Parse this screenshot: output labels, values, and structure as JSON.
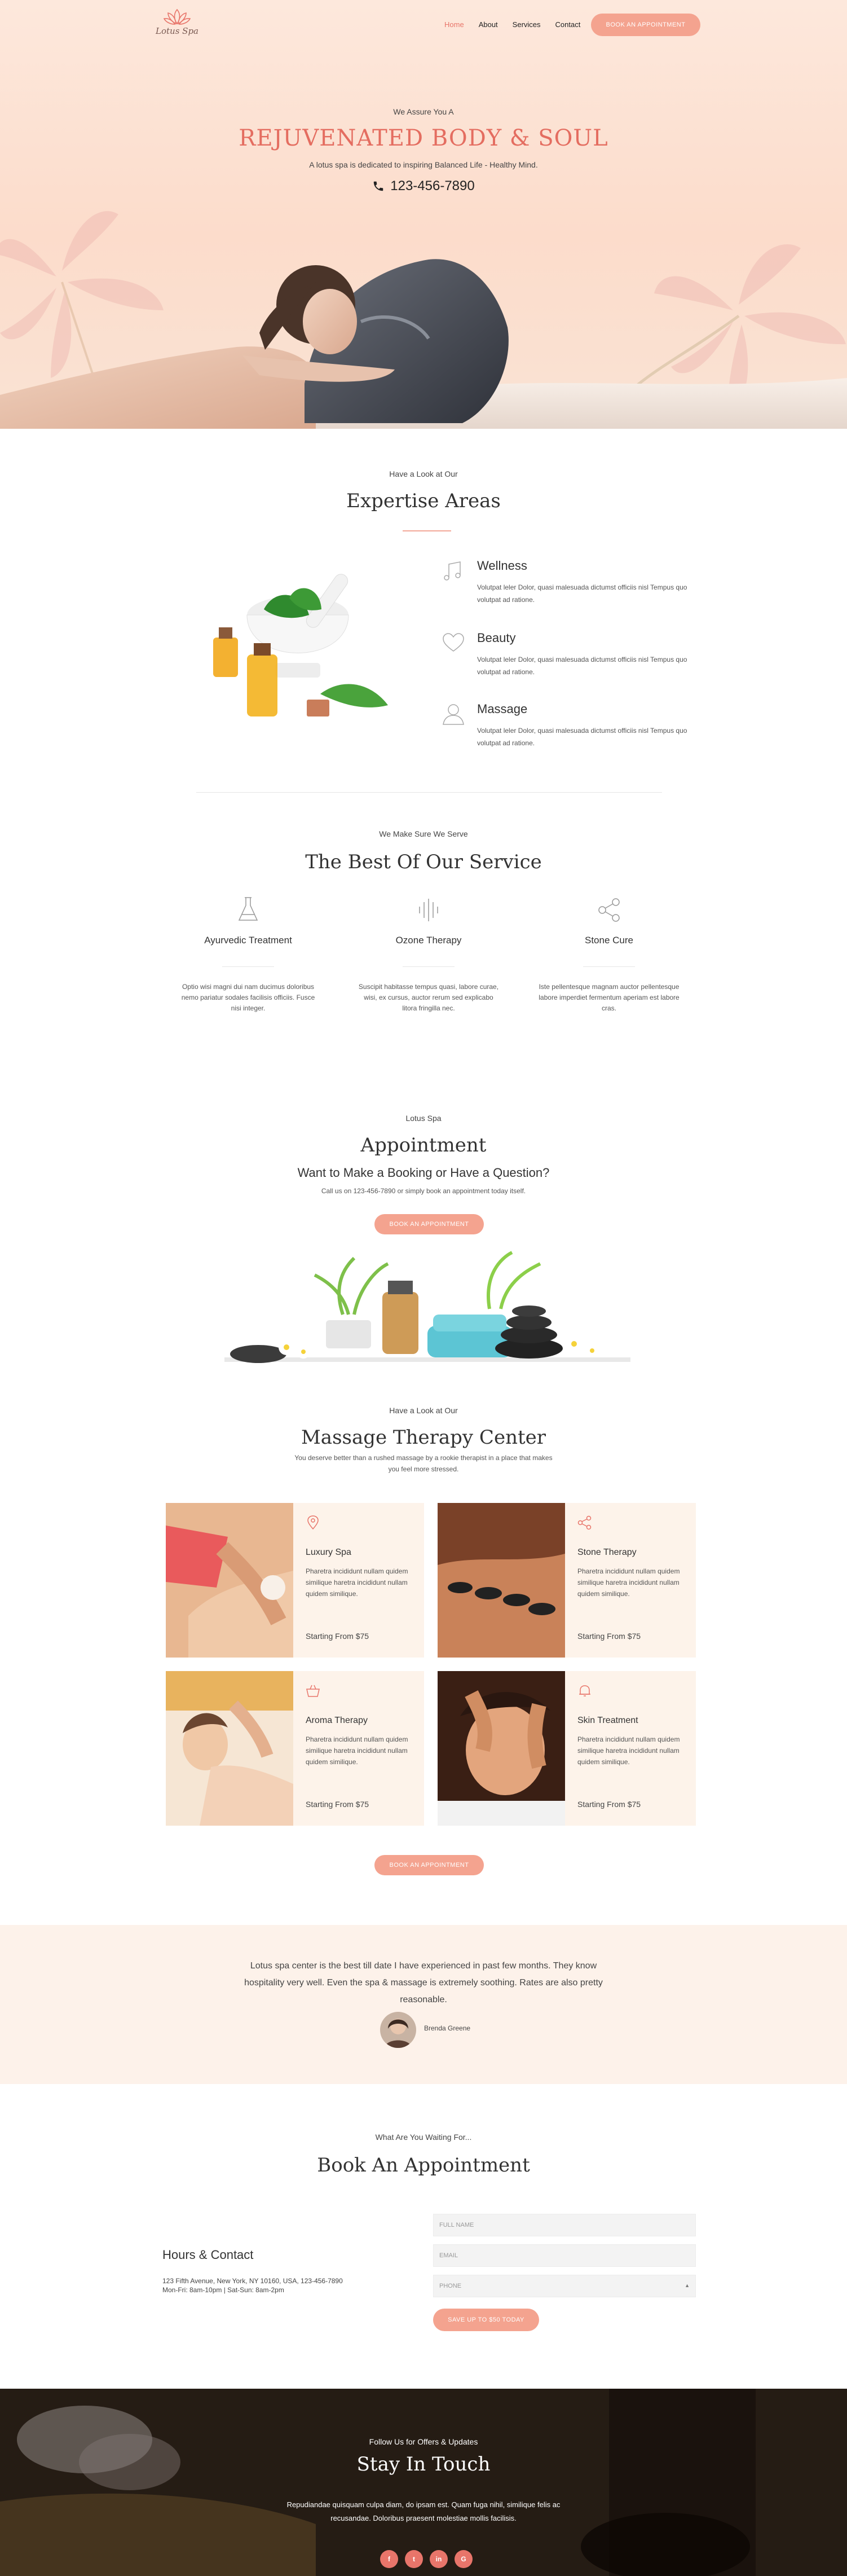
{
  "brand": {
    "logo_text": "Lotus Spa"
  },
  "nav": {
    "links": [
      "Home",
      "About",
      "Services",
      "Contact"
    ],
    "cta": "BOOK AN APPOINTMENT"
  },
  "hero": {
    "kicker": "We Assure You A",
    "title": "REJUVENATED BODY & SOUL",
    "subtitle": "A lotus spa is dedicated to inspiring Balanced Life - Healthy Mind.",
    "phone": "123-456-7890"
  },
  "expertise": {
    "kicker": "Have a Look at Our",
    "title": "Expertise Areas",
    "items": [
      {
        "icon": "music-note-icon",
        "title": "Wellness",
        "text": "Volutpat leler Dolor, quasi malesuada dictumst officiis nisl Tempus quo volutpat ad ratione."
      },
      {
        "icon": "heart-icon",
        "title": "Beauty",
        "text": "Volutpat leler Dolor, quasi malesuada dictumst officiis nisl Tempus quo volutpat ad ratione."
      },
      {
        "icon": "user-icon",
        "title": "Massage",
        "text": "Volutpat leler Dolor, quasi malesuada dictumst officiis nisl Tempus quo volutpat ad ratione."
      }
    ]
  },
  "services": {
    "kicker": "We Make Sure We Serve",
    "title": "The Best Of Our Service",
    "items": [
      {
        "icon": "flask-icon",
        "title": "Ayurvedic Treatment",
        "text": "Optio wisi magni dui nam ducimus doloribus nemo pariatur sodales facilisis officiis. Fusce nisi integer."
      },
      {
        "icon": "soundwave-icon",
        "title": "Ozone Therapy",
        "text": "Suscipit habitasse tempus quasi, labore curae, wisi, ex cursus, auctor rerum sed explicabo litora fringilla nec."
      },
      {
        "icon": "share-icon",
        "title": "Stone Cure",
        "text": "Iste pellentesque magnam auctor pellentesque labore imperdiet fermentum aperiam est labore cras."
      }
    ]
  },
  "appointment": {
    "kicker": "Lotus Spa",
    "title": "Appointment",
    "question": "Want to Make a Booking or Have a Question?",
    "call": "Call us on 123-456-7890 or simply book an appointment today itself.",
    "button": "BOOK AN APPOINTMENT"
  },
  "massage": {
    "kicker": "Have a Look at Our",
    "title": "Massage Therapy Center",
    "intro": "You deserve better than a rushed massage by a rookie therapist in a place that makes you feel more stressed.",
    "cards": [
      {
        "icon": "location-pin-icon",
        "title": "Luxury Spa",
        "text": "Pharetra incididunt nullam quidem similique haretra incididunt nullam quidem similique.",
        "price": "Starting From $75"
      },
      {
        "icon": "share-icon",
        "title": "Stone Therapy",
        "text": "Pharetra incididunt nullam quidem similique haretra incididunt nullam quidem similique.",
        "price": "Starting From $75"
      },
      {
        "icon": "basket-icon",
        "title": "Aroma Therapy",
        "text": "Pharetra incididunt nullam quidem similique haretra incididunt nullam quidem similique.",
        "price": "Starting From $75"
      },
      {
        "icon": "bell-icon",
        "title": "Skin Treatment",
        "text": "Pharetra incididunt nullam quidem similique haretra incididunt nullam quidem similique.",
        "price": "Starting From $75"
      }
    ],
    "button": "BOOK AN APPOINTMENT"
  },
  "testimonial": {
    "quote": "Lotus spa center is the best till date I have experienced in past few months. They know hospitality very well. Even the spa & massage is extremely soothing. Rates are also pretty reasonable.",
    "author": "Brenda Greene"
  },
  "book": {
    "kicker": "What Are You Waiting For...",
    "title": "Book An Appointment",
    "hours_title": "Hours & Contact",
    "address": "123 Fifth Avenue, New York, NY 10160, USA, 123-456-7890",
    "hours": "Mon-Fri: 8am-10pm | Sat-Sun: 8am-2pm",
    "fields": {
      "name": "FULL NAME",
      "email": "EMAIL",
      "phone": "PHONE"
    },
    "submit": "SAVE UP TO $50 TODAY"
  },
  "footer": {
    "kicker": "Follow Us for Offers & Updates",
    "title": "Stay In Touch",
    "text": "Repudiandae quisquam culpa diam, do ipsam est. Quam fuga nihil, similique felis ac recusandae. Doloribus praesent molestiae mollis facilisis.",
    "social": [
      "f",
      "t",
      "in",
      "G"
    ]
  },
  "colors": {
    "accent": "#e8756a",
    "button": "#f4a38f",
    "cream": "#fdf3ea"
  }
}
